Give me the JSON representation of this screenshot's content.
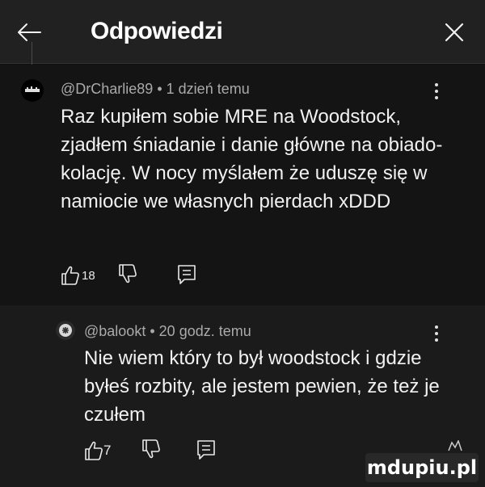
{
  "header": {
    "back_icon": "arrow-left-icon",
    "title": "Odpowiedzi",
    "close_icon": "close-icon"
  },
  "comments": [
    {
      "author": "@DrCharlie89",
      "separator": "•",
      "time": "1 dzień temu",
      "text": "Raz kupiłem sobie MRE na Woodstock, zjadłem śniadanie i danie główne na obiado-kolację. W nocy myślałem że uduszę się w namiocie we własnych pierdach xDDD",
      "likes": "18",
      "like_icon": "thumbs-up-icon",
      "dislike_icon": "thumbs-down-icon",
      "reply_icon": "reply-icon",
      "more_icon": "more-vertical-icon"
    },
    {
      "author": "@balookt",
      "separator": "•",
      "time": "20 godz. temu",
      "text": "Nie wiem który to był woodstock i gdzie byłeś rozbity, ale jestem pewien, że też je czułem",
      "likes": "7",
      "like_icon": "thumbs-up-icon",
      "dislike_icon": "thumbs-down-icon",
      "reply_icon": "reply-icon",
      "more_icon": "more-vertical-icon"
    }
  ],
  "watermark": "mdupiu.pl",
  "colors": {
    "background": "#0f0f0f",
    "header_bg": "#212121",
    "text_primary": "#f1f1f1",
    "text_secondary": "#aaaaaa"
  }
}
